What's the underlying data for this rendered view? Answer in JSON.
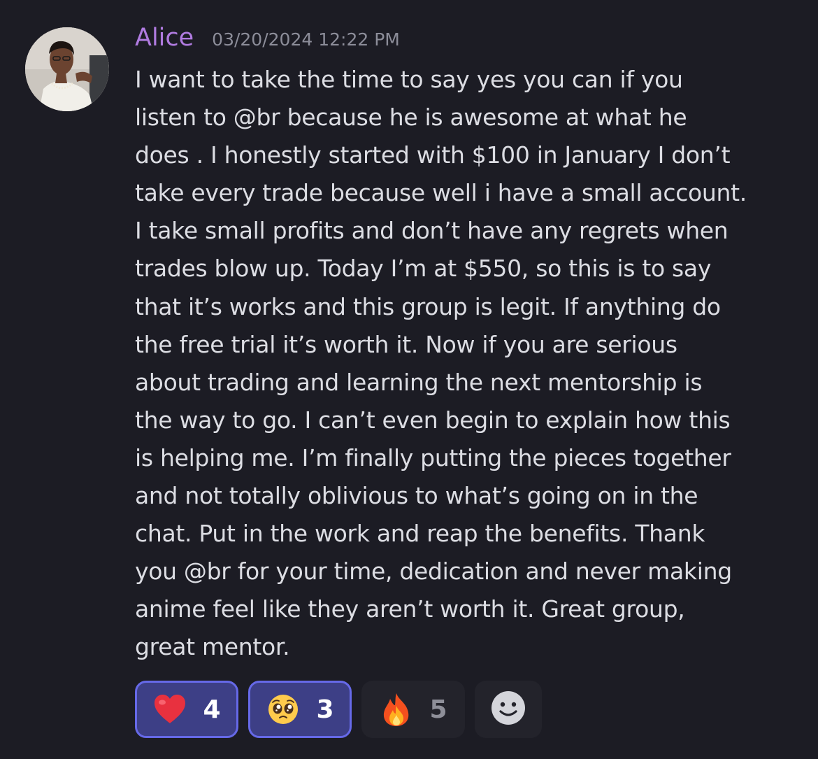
{
  "message": {
    "username": "Alice",
    "timestamp": "03/20/2024 12:22 PM",
    "lines": [
      "I want to take the time to say yes you can if you",
      "listen to @br because he is awesome at what he",
      "does . I honestly started with $100 in January I don’t",
      "take every trade because well i have a small account.",
      "I take small profits and don’t have any regrets when",
      "trades blow up. Today I’m at $550, so this is to say",
      "that it’s works and this group is legit. If anything do",
      "the free trial it’s worth it. Now if you are serious",
      "about trading and learning the next mentorship is",
      "the way to go. I can’t even begin to explain how this",
      "is helping me. I’m finally putting the pieces together",
      "and not totally oblivious to what’s going on in the",
      "chat. Put in the work and reap the benefits. Thank",
      "you @br for your time, dedication and never making",
      "anime feel like they aren’t worth it. Great group,",
      "great mentor."
    ]
  },
  "reactions": [
    {
      "icon": "heart-emoji",
      "count": "4",
      "active": true
    },
    {
      "icon": "pleading-face-emoji",
      "count": "3",
      "active": true
    },
    {
      "icon": "fire-emoji",
      "count": "5",
      "active": false
    }
  ],
  "add_reaction": {
    "icon": "smiley-add-reaction-icon"
  },
  "colors": {
    "background": "#1c1c24",
    "username": "#b07be0",
    "timestamp": "#8c8d99",
    "text": "#dcdde3",
    "reaction_active_bg": "#3d3f86",
    "reaction_active_border": "#6669e8",
    "reaction_inactive_bg": "#23232b"
  }
}
